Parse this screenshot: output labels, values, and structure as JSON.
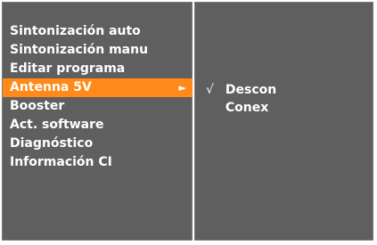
{
  "menu": {
    "items": [
      {
        "label": "Sintonización auto"
      },
      {
        "label": "Sintonización manu"
      },
      {
        "label": "Editar programa"
      },
      {
        "label": "Antenna 5V",
        "selected": true,
        "arrow": "►"
      },
      {
        "label": "Booster"
      },
      {
        "label": "Act. software"
      },
      {
        "label": "Diagnóstico"
      },
      {
        "label": "Información CI"
      }
    ]
  },
  "submenu": {
    "options": [
      {
        "check": "√",
        "label": "Descon",
        "checked": true
      },
      {
        "check": "",
        "label": "Conex",
        "checked": false
      }
    ]
  },
  "colors": {
    "panel": "#5f5f5f",
    "highlight": "#ff8a1a",
    "text": "#ffffff"
  }
}
